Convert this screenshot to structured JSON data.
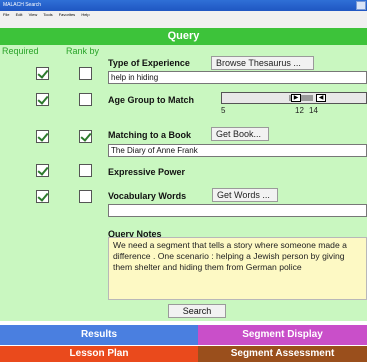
{
  "window": {
    "title": "MALACH Search"
  },
  "menu": [
    "File",
    "Edit",
    "View",
    "Tools",
    "Favorites",
    "Help"
  ],
  "query": {
    "header": "Query",
    "col_required": "Required",
    "col_rank": "Rank by",
    "rows": [
      {
        "label": "Type of Experience",
        "button": "Browse Thesaurus ...",
        "value": "help in hiding",
        "required": true,
        "rank": false
      },
      {
        "label": "Age Group to Match",
        "required": true,
        "rank": false,
        "slider": {
          "tick_min": "5",
          "tick_low": "12",
          "tick_high": "14",
          "low": 12,
          "high": 14
        }
      },
      {
        "label": "Matching to a Book",
        "button": "Get Book...",
        "value": "The Diary of Anne Frank",
        "required": true,
        "rank": true
      },
      {
        "label": "Expressive Power",
        "required": true,
        "rank": false
      },
      {
        "label": "Vocabulary Words",
        "button": "Get Words ...",
        "value": "",
        "required": true,
        "rank": false
      }
    ],
    "notes_label": "Query Notes",
    "notes_text": "We need a segment that tells a story where someone made a difference . One scenario : helping a Jewish person by giving them shelter and hiding them from German police",
    "search_label": "Search"
  },
  "tabs": {
    "results": "Results",
    "segment_display": "Segment Display",
    "lesson_plan": "Lesson Plan",
    "segment_assessment": "Segment Assessment"
  },
  "colors": {
    "query_header": "#3dc33a",
    "panel_bg": "#c9f7c0",
    "results_tab": "#4a7fe0",
    "segment_display_tab": "#c94fc9",
    "lesson_plan_tab": "#ea4a1c",
    "segment_assessment_tab": "#9a4f1c"
  }
}
